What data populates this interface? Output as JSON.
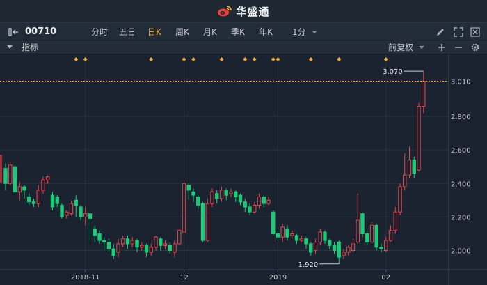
{
  "app": {
    "brand": "华盛通",
    "brand_color": "#e8423c",
    "icon": "weibo-logo-icon"
  },
  "toolbar": {
    "stock_code": "00710",
    "periods": [
      {
        "label": "分时",
        "active": false
      },
      {
        "label": "五日",
        "active": false
      },
      {
        "label": "日K",
        "active": true
      },
      {
        "label": "周K",
        "active": false
      },
      {
        "label": "月K",
        "active": false
      },
      {
        "label": "季K",
        "active": false
      },
      {
        "label": "年K",
        "active": false
      }
    ],
    "interval": "1分",
    "icons": [
      "pencil-icon",
      "fullscreen-icon",
      "close-icon"
    ]
  },
  "indicator_bar": {
    "label": "指标",
    "adjust": "前复权",
    "icons": [
      "collapse-arrow-icon",
      "plus-icon",
      "minus-icon",
      "gear-icon"
    ]
  },
  "colors": {
    "up": "#e4474b",
    "down": "#1fc97a",
    "accent": "#f0a93a",
    "grid": "#2a3342"
  },
  "chart_data": {
    "type": "candlestick",
    "ylim": [
      1.89,
      3.17
    ],
    "y_ticks": [
      "3.010",
      "2.800",
      "2.600",
      "2.400",
      "2.200",
      "2.000"
    ],
    "x_ticks": [
      "2018-11",
      "12",
      "2019",
      "02"
    ],
    "last_price": "3.010",
    "annotations": {
      "high": "3.070",
      "low": "1.920"
    },
    "event_marker_count": 13,
    "candles": [
      [
        2.49,
        2.4,
        2.52,
        2.36
      ],
      [
        2.4,
        2.51,
        2.53,
        2.39
      ],
      [
        2.5,
        2.35,
        2.51,
        2.33
      ],
      [
        2.35,
        2.38,
        2.41,
        2.3
      ],
      [
        2.38,
        2.36,
        2.39,
        2.31
      ],
      [
        2.32,
        2.29,
        2.34,
        2.27
      ],
      [
        2.29,
        2.28,
        2.31,
        2.26
      ],
      [
        2.28,
        2.36,
        2.39,
        2.26
      ],
      [
        2.36,
        2.42,
        2.44,
        2.34
      ],
      [
        2.42,
        2.44,
        2.45,
        2.4
      ],
      [
        2.33,
        2.26,
        2.35,
        2.24
      ],
      [
        2.32,
        2.28,
        2.33,
        2.26
      ],
      [
        2.27,
        2.2,
        2.28,
        2.19
      ],
      [
        2.21,
        2.23,
        2.24,
        2.19
      ],
      [
        2.22,
        2.28,
        2.3,
        2.21
      ],
      [
        2.3,
        2.27,
        2.33,
        2.2
      ],
      [
        2.26,
        2.2,
        2.27,
        2.18
      ],
      [
        2.2,
        2.22,
        2.26,
        2.15
      ],
      [
        2.22,
        2.19,
        2.23,
        2.05
      ],
      [
        2.13,
        2.09,
        2.15,
        2.05
      ],
      [
        2.1,
        2.06,
        2.12,
        2.04
      ],
      [
        2.06,
        2.05,
        2.08,
        2.0
      ],
      [
        2.05,
        2.01,
        2.07,
        1.99
      ],
      [
        2.01,
        1.97,
        2.04,
        1.95
      ],
      [
        1.99,
        2.04,
        2.07,
        1.96
      ],
      [
        2.04,
        2.07,
        2.09,
        2.02
      ],
      [
        2.07,
        2.04,
        2.09,
        2.01
      ],
      [
        2.04,
        2.06,
        2.08,
        2.02
      ],
      [
        2.06,
        2.02,
        2.07,
        1.99
      ],
      [
        2.02,
        2.03,
        2.05,
        2.0
      ],
      [
        2.03,
        1.99,
        2.04,
        1.96
      ],
      [
        1.99,
        2.02,
        2.04,
        1.97
      ],
      [
        2.02,
        2.08,
        2.09,
        2.0
      ],
      [
        2.07,
        2.03,
        2.08,
        2.0
      ],
      [
        2.03,
        2.04,
        2.06,
        2.01
      ],
      [
        2.03,
        2.0,
        2.05,
        1.98
      ],
      [
        1.99,
        2.04,
        2.06,
        1.96
      ],
      [
        2.04,
        2.12,
        2.13,
        2.03
      ],
      [
        2.11,
        2.4,
        2.42,
        2.1
      ],
      [
        2.39,
        2.36,
        2.4,
        2.3
      ],
      [
        2.35,
        2.33,
        2.37,
        2.29
      ],
      [
        2.32,
        2.27,
        2.33,
        2.25
      ],
      [
        2.28,
        2.06,
        2.29,
        2.05
      ],
      [
        2.06,
        2.28,
        2.31,
        2.05
      ],
      [
        2.28,
        2.35,
        2.37,
        2.26
      ],
      [
        2.34,
        2.31,
        2.36,
        2.28
      ],
      [
        2.31,
        2.36,
        2.38,
        2.29
      ],
      [
        2.36,
        2.33,
        2.37,
        2.3
      ],
      [
        2.34,
        2.35,
        2.37,
        2.32
      ],
      [
        2.35,
        2.32,
        2.36,
        2.29
      ],
      [
        2.33,
        2.29,
        2.34,
        2.27
      ],
      [
        2.29,
        2.26,
        2.31,
        2.23
      ],
      [
        2.26,
        2.23,
        2.28,
        2.21
      ],
      [
        2.23,
        2.27,
        2.29,
        2.22
      ],
      [
        2.27,
        2.32,
        2.34,
        2.25
      ],
      [
        2.32,
        2.28,
        2.33,
        2.26
      ],
      [
        2.28,
        2.3,
        2.32,
        2.27
      ],
      [
        2.23,
        2.1,
        2.24,
        2.09
      ],
      [
        2.1,
        2.08,
        2.12,
        2.06
      ],
      [
        2.08,
        2.14,
        2.16,
        2.05
      ],
      [
        2.13,
        2.08,
        2.15,
        2.06
      ],
      [
        2.09,
        2.1,
        2.12,
        2.07
      ],
      [
        2.09,
        2.06,
        2.1,
        2.04
      ],
      [
        2.06,
        2.07,
        2.09,
        2.05
      ],
      [
        2.07,
        2.04,
        2.08,
        2.01
      ],
      [
        2.04,
        1.99,
        2.05,
        1.97
      ],
      [
        2.0,
        2.05,
        2.07,
        1.98
      ],
      [
        2.05,
        2.11,
        2.13,
        2.03
      ],
      [
        2.11,
        2.06,
        2.12,
        2.04
      ],
      [
        2.06,
        2.03,
        2.07,
        2.01
      ],
      [
        2.03,
        2.0,
        2.05,
        1.98
      ],
      [
        2.05,
        1.96,
        2.06,
        1.92
      ],
      [
        1.97,
        1.99,
        2.01,
        1.95
      ],
      [
        1.99,
        2.02,
        2.03,
        1.97
      ],
      [
        2.0,
        2.04,
        2.07,
        1.99
      ],
      [
        2.05,
        2.18,
        2.34,
        2.04
      ],
      [
        2.22,
        2.1,
        2.23,
        2.08
      ],
      [
        2.1,
        2.05,
        2.12,
        2.03
      ],
      [
        2.05,
        2.15,
        2.17,
        2.04
      ],
      [
        2.15,
        2.02,
        2.16,
        2.0
      ],
      [
        2.02,
        2.01,
        2.04,
        1.99
      ],
      [
        2.0,
        2.06,
        2.08,
        1.99
      ],
      [
        2.06,
        2.12,
        2.15,
        2.05
      ],
      [
        2.12,
        2.23,
        2.26,
        2.1
      ],
      [
        2.23,
        2.38,
        2.4,
        2.21
      ],
      [
        2.38,
        2.45,
        2.58,
        2.36
      ],
      [
        2.45,
        2.54,
        2.62,
        2.43
      ],
      [
        2.54,
        2.46,
        2.56,
        2.43
      ],
      [
        2.48,
        2.86,
        2.88,
        2.47
      ],
      [
        2.86,
        3.01,
        3.07,
        2.82
      ]
    ]
  }
}
